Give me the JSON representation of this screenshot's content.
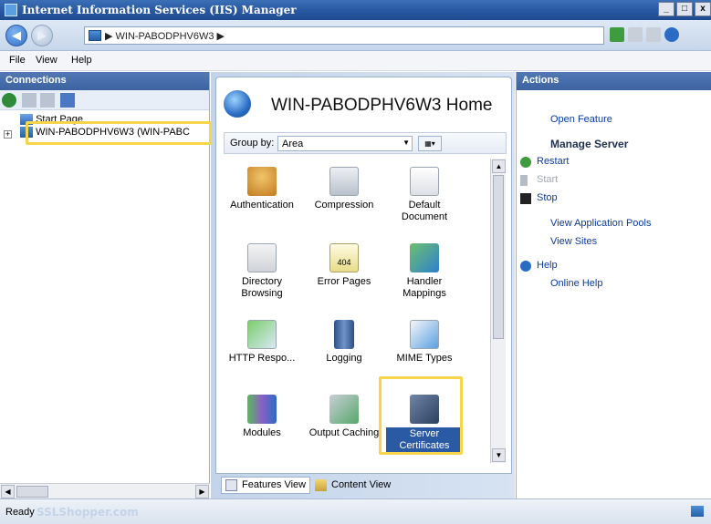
{
  "window": {
    "title": "Internet Information Services (IIS) Manager",
    "controls": [
      "_",
      "□",
      "x"
    ]
  },
  "address": {
    "back_glyph": "◀",
    "forward_glyph": "▶",
    "crumb": "▶  WIN-PABODPHV6W3  ▶"
  },
  "menu": {
    "file": "File",
    "view": "View",
    "help": "Help"
  },
  "connections": {
    "header": "Connections",
    "tree": [
      {
        "label": "Start Page",
        "icon": "start-page-icon"
      },
      {
        "label": "WIN-PABODPHV6W3 (WIN-PABC",
        "icon": "server-icon",
        "expander": "+"
      }
    ]
  },
  "home": {
    "title": "WIN-PABODPHV6W3 Home",
    "group_by_label": "Group by:",
    "group_by_value": "Area",
    "features": [
      {
        "label": "Authentication",
        "icon": "authentication-icon"
      },
      {
        "label": "Compression",
        "icon": "compression-icon"
      },
      {
        "label": "Default Document",
        "icon": "default-document-icon"
      },
      {
        "label": "Directory Browsing",
        "icon": "directory-browsing-icon"
      },
      {
        "label": "Error Pages",
        "icon": "error-pages-icon"
      },
      {
        "label": "Handler Mappings",
        "icon": "handler-mappings-icon"
      },
      {
        "label": "HTTP Respo...",
        "icon": "http-response-icon"
      },
      {
        "label": "Logging",
        "icon": "logging-icon"
      },
      {
        "label": "MIME Types",
        "icon": "mime-types-icon"
      },
      {
        "label": "Modules",
        "icon": "modules-icon"
      },
      {
        "label": "Output Caching",
        "icon": "output-caching-icon"
      },
      {
        "label": "Server Certificates",
        "icon": "server-certificates-icon",
        "selected": true
      }
    ],
    "error_pages_badge": "404",
    "tabs": {
      "features_view": "Features View",
      "content_view": "Content View"
    }
  },
  "actions": {
    "header": "Actions",
    "open_feature": "Open Feature",
    "manage_server": "Manage Server",
    "restart": "Restart",
    "start": "Start",
    "stop": "Stop",
    "view_app_pools": "View Application Pools",
    "view_sites": "View Sites",
    "help": "Help",
    "online_help": "Online Help"
  },
  "status": {
    "text": "Ready",
    "watermark": "SSLShopper.com"
  },
  "colors": {
    "header_blue": "#3c62a0",
    "link_blue": "#0a3b9f",
    "highlight_yellow": "#f6d54b",
    "selection_blue": "#2a5aa3"
  }
}
